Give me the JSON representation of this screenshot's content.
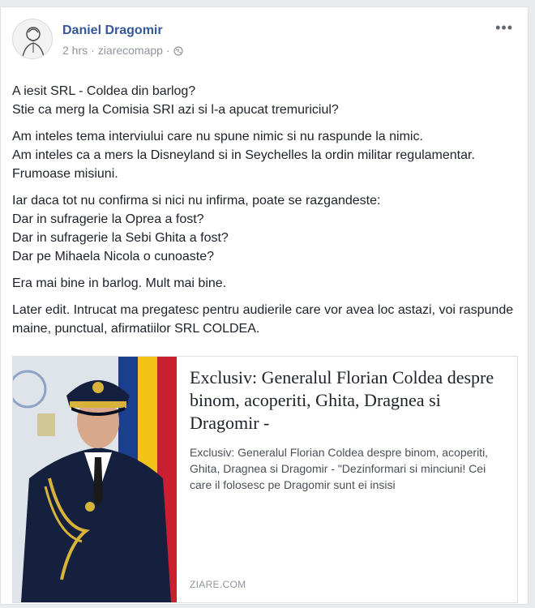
{
  "post": {
    "author": "Daniel Dragomir",
    "time": "2 hrs",
    "app": "ziarecomapp",
    "more_label": "•••",
    "paragraphs": [
      [
        "A iesit SRL - Coldea din barlog?",
        "Stie ca merg la Comisia SRI azi si l-a apucat tremuriciul?"
      ],
      [
        "Am inteles tema interviului care nu spune nimic si nu raspunde la nimic.",
        "Am inteles ca a mers la Disneyland si in Seychelles la ordin militar regulamentar. Frumoase misiuni."
      ],
      [
        "Iar daca tot nu confirma si nici nu infirma, poate se razgandeste:",
        "Dar in sufragerie la Oprea a fost?",
        "Dar in sufragerie la Sebi Ghita a fost?",
        "Dar pe Mihaela Nicola o cunoaste?"
      ],
      [
        "Era mai bine in barlog. Mult mai bine."
      ],
      [
        "Later edit. Intrucat ma pregatesc pentru audierile care vor avea loc astazi, voi raspunde maine, punctual, afirmatiilor SRL COLDEA."
      ]
    ]
  },
  "link": {
    "title": "Exclusiv: Generalul Florian Coldea despre binom, acoperiti, Ghita, Dragnea si Dragomir -",
    "description": "Exclusiv: Generalul Florian Coldea despre binom, acoperiti, Ghita, Dragnea si Dragomir - \"Dezinformari si minciuni! Cei care il folosesc pe Dragomir sunt ei insisi",
    "source": "ZIARE.COM"
  },
  "colors": {
    "author": "#365899",
    "meta": "#90949c",
    "text": "#1d2129"
  },
  "icons": {
    "avatar": "avatar-sketch",
    "privacy": "globe-icon",
    "more": "more-options-icon"
  }
}
